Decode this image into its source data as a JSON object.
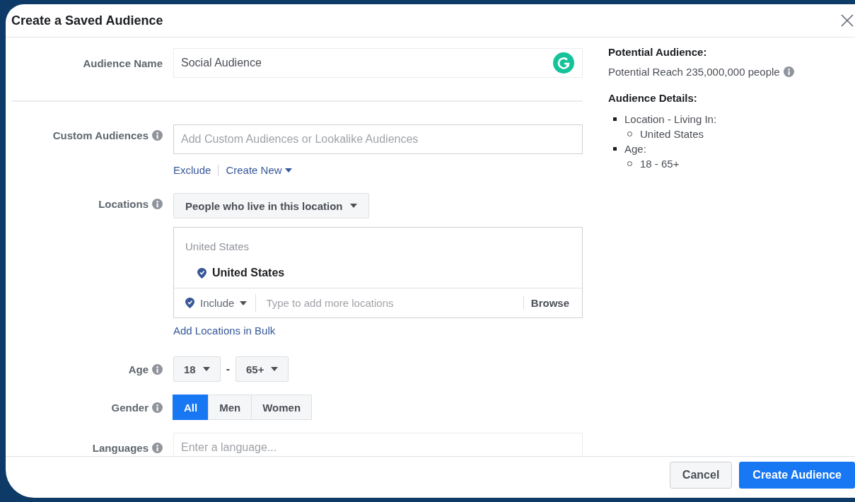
{
  "dialog": {
    "title": "Create a Saved Audience"
  },
  "audience_name": {
    "label": "Audience Name",
    "value": "Social Audience"
  },
  "custom_audiences": {
    "label": "Custom Audiences",
    "placeholder": "Add Custom Audiences or Lookalike Audiences",
    "links": [
      {
        "label": "Exclude",
        "dropdown": false
      },
      {
        "label": "Create New",
        "dropdown": true
      }
    ]
  },
  "locations": {
    "label": "Locations",
    "mode": "People who live in this location",
    "heading": "United States",
    "selected": [
      "United States"
    ],
    "include": "Include",
    "placeholder": "Type to add more locations",
    "browse": "Browse",
    "bulk_link": "Add Locations in Bulk"
  },
  "age": {
    "label": "Age",
    "min": "18",
    "separator": "-",
    "max": "65+"
  },
  "gender": {
    "label": "Gender",
    "options": [
      {
        "label": "All",
        "selected": true
      },
      {
        "label": "Men",
        "selected": false
      },
      {
        "label": "Women",
        "selected": false
      }
    ]
  },
  "languages": {
    "label": "Languages",
    "placeholder": "Enter a language..."
  },
  "summary": {
    "title": "Potential Audience:",
    "reach": "Potential Reach 235,000,000 people",
    "details_title": "Audience Details:",
    "details": [
      {
        "text": "Location - Living In:",
        "children": [
          {
            "text": "United States"
          }
        ]
      },
      {
        "text": "Age:",
        "children": [
          {
            "text": "18 - 65+"
          }
        ]
      }
    ]
  },
  "buttons": [
    {
      "label": "Cancel",
      "kind": "secondary"
    },
    {
      "label": "Create Audience",
      "kind": "primary"
    }
  ]
}
